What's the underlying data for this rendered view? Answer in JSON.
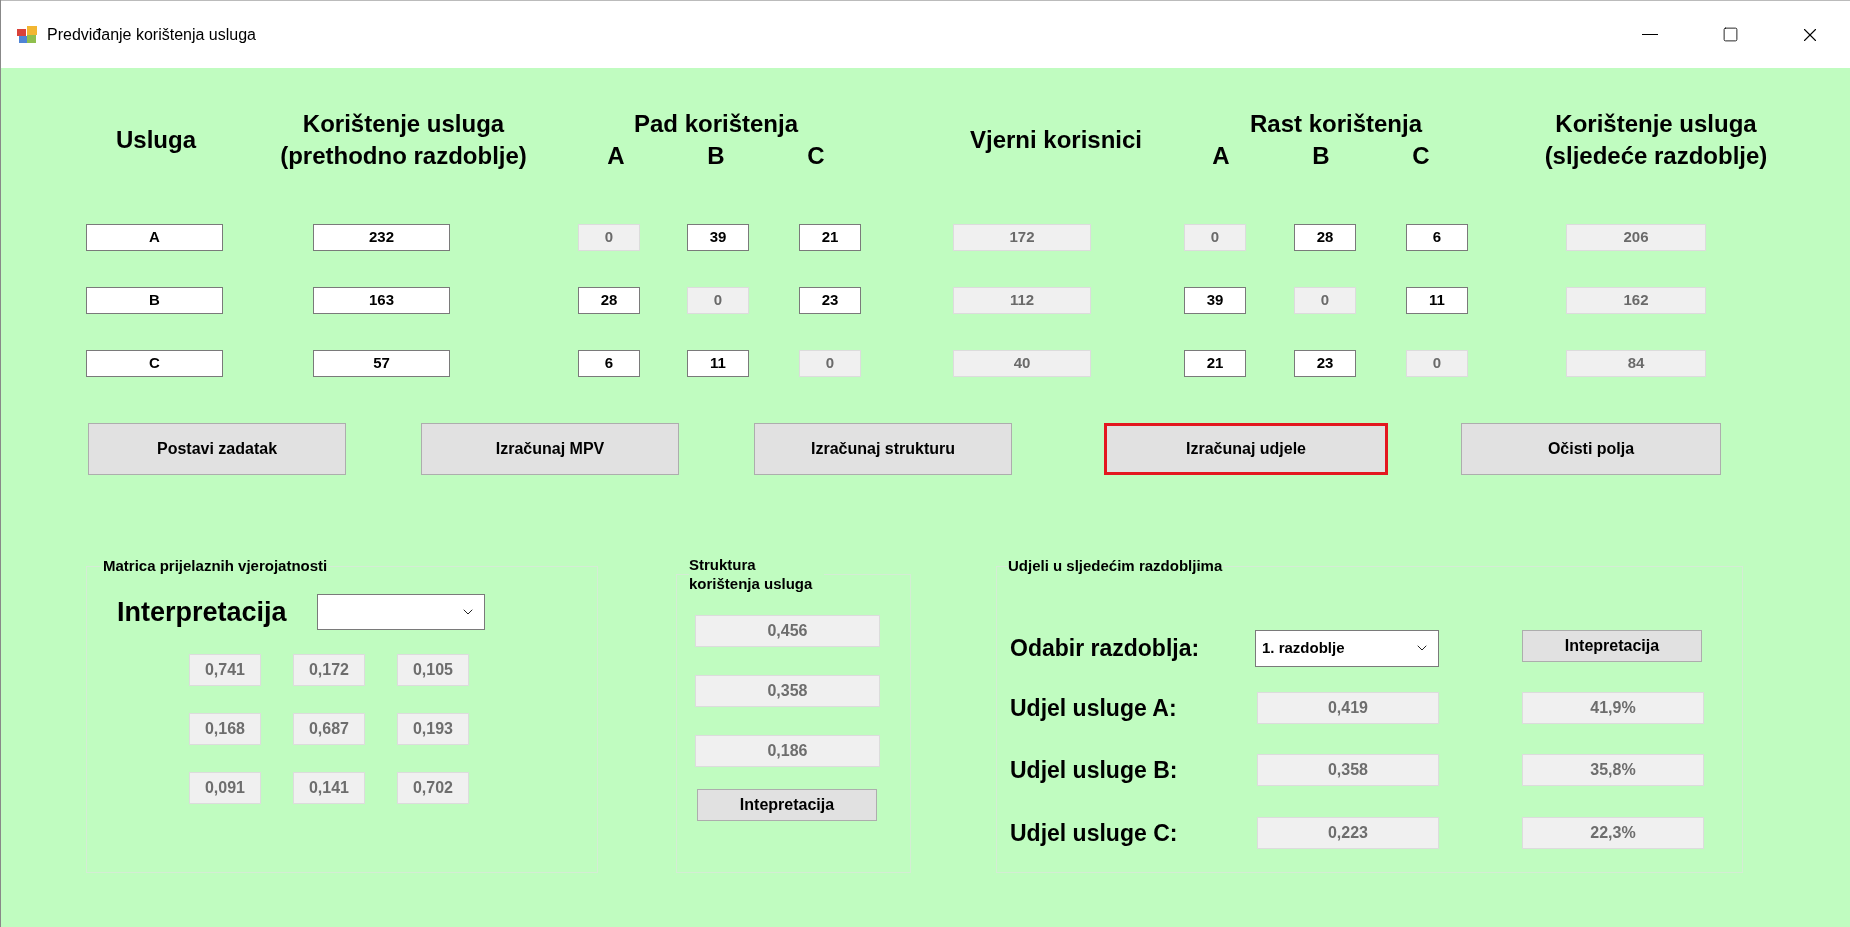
{
  "window": {
    "title": "Predviđanje korištenja usluga"
  },
  "header": {
    "service": "Usluga",
    "previous": "Korištenje usluga (prethodno razdoblje)",
    "decrease": {
      "title": "Pad korištenja",
      "columns": [
        "A",
        "B",
        "C"
      ]
    },
    "loyal": "Vjerni korisnici",
    "increase": {
      "title": "Rast korištenja",
      "columns": [
        "A",
        "B",
        "C"
      ]
    },
    "next": "Korištenje usluga (sljedeće razdoblje)"
  },
  "rows": [
    {
      "cells": [
        {
          "value": "A",
          "disabled": false
        },
        {
          "value": "232",
          "disabled": false
        },
        {
          "value": "0",
          "disabled": true
        },
        {
          "value": "39",
          "disabled": false
        },
        {
          "value": "21",
          "disabled": false
        },
        {
          "value": "172",
          "disabled": true
        },
        {
          "value": "0",
          "disabled": true
        },
        {
          "value": "28",
          "disabled": false
        },
        {
          "value": "6",
          "disabled": false
        },
        {
          "value": "206",
          "disabled": true
        }
      ]
    },
    {
      "cells": [
        {
          "value": "B",
          "disabled": false
        },
        {
          "value": "163",
          "disabled": false
        },
        {
          "value": "28",
          "disabled": false
        },
        {
          "value": "0",
          "disabled": true
        },
        {
          "value": "23",
          "disabled": false
        },
        {
          "value": "112",
          "disabled": true
        },
        {
          "value": "39",
          "disabled": false
        },
        {
          "value": "0",
          "disabled": true
        },
        {
          "value": "11",
          "disabled": false
        },
        {
          "value": "162",
          "disabled": true
        }
      ]
    },
    {
      "cells": [
        {
          "value": "C",
          "disabled": false
        },
        {
          "value": "57",
          "disabled": false
        },
        {
          "value": "6",
          "disabled": false
        },
        {
          "value": "11",
          "disabled": false
        },
        {
          "value": "0",
          "disabled": true
        },
        {
          "value": "40",
          "disabled": true
        },
        {
          "value": "21",
          "disabled": false
        },
        {
          "value": "23",
          "disabled": false
        },
        {
          "value": "0",
          "disabled": true
        },
        {
          "value": "84",
          "disabled": true
        }
      ]
    }
  ],
  "buttons": [
    {
      "label": "Postavi zadatak",
      "highlighted": false
    },
    {
      "label": "Izračunaj MPV",
      "highlighted": false
    },
    {
      "label": "Izračunaj strukturu",
      "highlighted": false
    },
    {
      "label": "Izračunaj udjele",
      "highlighted": true
    },
    {
      "label": "Očisti polja",
      "highlighted": false
    }
  ],
  "transition_matrix": {
    "title": "Matrica prijelaznih vjerojatnosti",
    "interpretation_label": "Interpretacija",
    "rows": [
      [
        "0,741",
        "0,172",
        "0,105"
      ],
      [
        "0,168",
        "0,687",
        "0,193"
      ],
      [
        "0,091",
        "0,141",
        "0,702"
      ]
    ]
  },
  "structure": {
    "title": "Struktura korištenja usluga",
    "values": [
      "0,456",
      "0,358",
      "0,186"
    ],
    "button": "Intepretacija"
  },
  "shares": {
    "title": "Udjeli u sljedećim razdobljima",
    "period_label": "Odabir razdoblja:",
    "period_value": "1. razdoblje",
    "button": "Intepretacija",
    "rows": [
      {
        "label": "Udjel usluge A:",
        "share": "0,419",
        "percent": "41,9%"
      },
      {
        "label": "Udjel usluge B:",
        "share": "0,358",
        "percent": "35,8%"
      },
      {
        "label": "Udjel usluge C:",
        "share": "0,223",
        "percent": "22,3%"
      }
    ]
  }
}
